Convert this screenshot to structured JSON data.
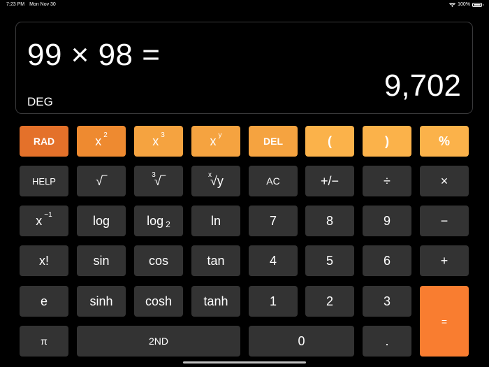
{
  "status_bar": {
    "time": "7:23 PM",
    "date": "Mon Nov 30",
    "battery": "100%",
    "battery_level": 1.0
  },
  "display": {
    "expression": "99 × 98 =",
    "result": "9,702",
    "angle_mode": "DEG"
  },
  "keys": {
    "rad": "RAD",
    "x_base": "x",
    "sq_exp": "2",
    "cube_exp": "3",
    "y_exp": "y",
    "del": "DEL",
    "open_paren": "(",
    "close_paren": ")",
    "percent": "%",
    "help": "HELP",
    "sqrt": "√‾",
    "cbrt_index": "3",
    "cbrt": "√‾",
    "xroot_index": "x",
    "xroot": "√y",
    "ac": "AC",
    "plus_minus": "+/−",
    "divide": "÷",
    "multiply": "×",
    "inv_exp": "−1",
    "log": "log",
    "log2_base": "log",
    "log2_sub": "2",
    "ln": "ln",
    "seven": "7",
    "eight": "8",
    "nine": "9",
    "minus": "−",
    "factorial": "x!",
    "sin": "sin",
    "cos": "cos",
    "tan": "tan",
    "four": "4",
    "five": "5",
    "six": "6",
    "plus": "+",
    "e": "e",
    "sinh": "sinh",
    "cosh": "cosh",
    "tanh": "tanh",
    "one": "1",
    "two": "2",
    "three": "3",
    "equals": "=",
    "pi": "π",
    "second": "2ND",
    "zero": "0",
    "decimal": "."
  },
  "colors": {
    "key_dark": "#333333",
    "orange_1": "#e4712a",
    "orange_2": "#ee8a30",
    "orange_3": "#f5a340",
    "orange_4": "#fbb24a",
    "equals": "#f97d30"
  }
}
